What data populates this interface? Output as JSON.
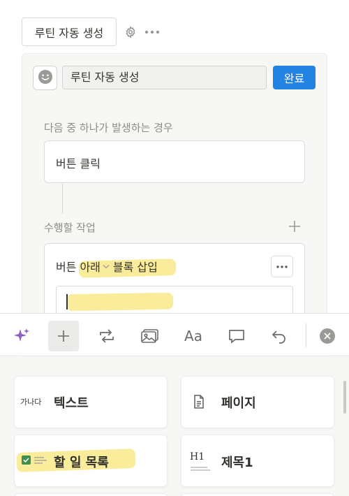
{
  "header": {
    "routine_title": "루틴 자동 생성",
    "icons": [
      "gear-icon",
      "more-dots-icon"
    ]
  },
  "editor": {
    "emoji_icon": "smiley-face-icon",
    "name_value": "루틴 자동 생성",
    "done_label": "완료",
    "trigger_section_label": "다음 중 하나가 발생하는 경우",
    "trigger_value": "버튼 클릭",
    "action_section_label": "수행할 작업",
    "action": {
      "prefix": "버튼",
      "position_option": "아래",
      "suffix": "블록 삽입"
    },
    "colors": {
      "accent": "#2383e2",
      "highlight": "#f8e98a"
    }
  },
  "toolbar": {
    "items": [
      "ai-sparkle-icon",
      "plus-icon",
      "turn-into-icon",
      "image-icon",
      "text-style-icon",
      "comment-icon",
      "undo-icon",
      "close-icon"
    ],
    "text_style_label": "Aa"
  },
  "blocks": [
    {
      "label": "텍스트",
      "icon_text": "가나다"
    },
    {
      "label": "페이지",
      "icon": "page-icon"
    },
    {
      "label": "할 일 목록",
      "icon": "todo-checkbox-icon"
    },
    {
      "label": "제목1",
      "icon": "heading1-icon",
      "icon_text": "H1"
    }
  ]
}
